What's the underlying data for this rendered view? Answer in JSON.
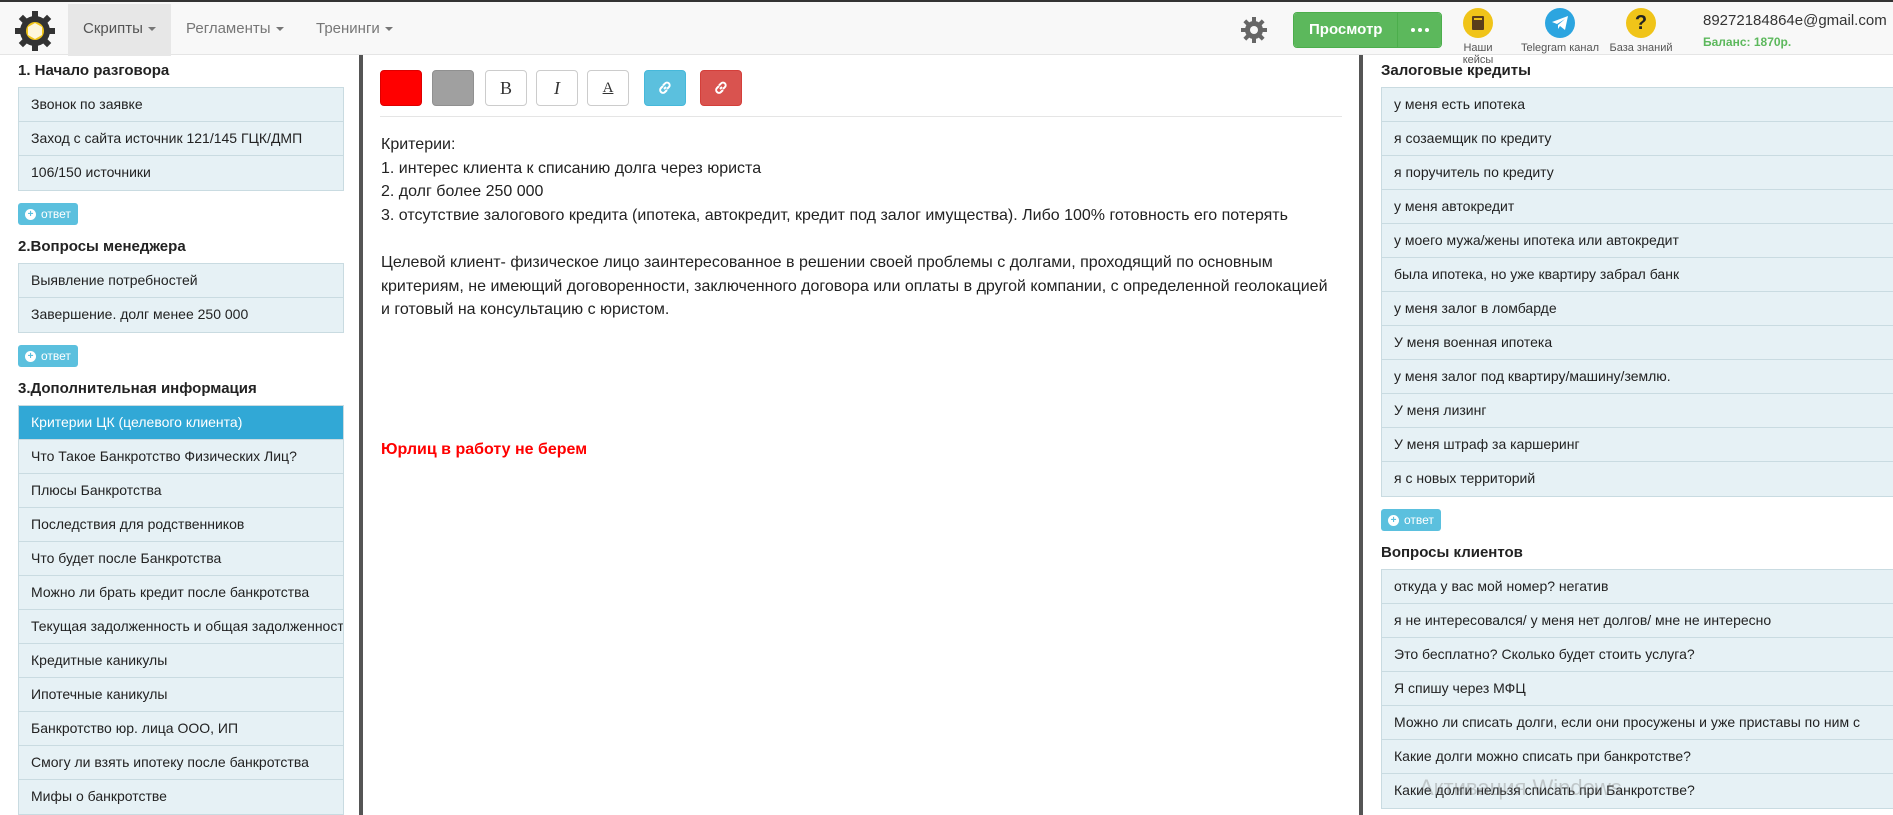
{
  "nav": {
    "items": [
      {
        "label": "Скрипты"
      },
      {
        "label": "Регламенты"
      },
      {
        "label": "Тренинги"
      }
    ],
    "view_label": "Просмотр",
    "links": [
      {
        "label": "Наши кейсы",
        "icon": "book-icon",
        "color": "#f0c419"
      },
      {
        "label": "Telegram канал",
        "icon": "telegram-icon",
        "color": "#2ca5e0"
      },
      {
        "label": "База знаний",
        "icon": "question-icon",
        "color": "#f0c419"
      }
    ],
    "user_email": "89272184864e@gmail.com",
    "balance": "Баланс: 1870р."
  },
  "left": {
    "sections": [
      {
        "title": "1. Начало разговора",
        "items": [
          "Звонок по заявке",
          "Заход с сайта источник 121/145 ГЦК/ДМП",
          "106/150 источники"
        ]
      },
      {
        "title": "2.Вопросы менеджера",
        "items": [
          "Выявление потребностей",
          "Завершение. долг менее 250 000"
        ]
      },
      {
        "title": "3.Дополнительная информация",
        "items": [
          "Критерии ЦК (целевого клиента)",
          "Что Такое Банкротство Физических Лиц?",
          "Плюсы Банкротства",
          "Последствия для родственников",
          "Что будет после Банкротства",
          "Можно ли брать кредит после банкротства",
          "Текущая задолженность и общая задолженность",
          "Кредитные каникулы",
          "Ипотечные каникулы",
          "Банкротство юр. лица ООО, ИП",
          "Смогу ли взять ипотеку после банкротства",
          "Мифы о банкротстве"
        ]
      }
    ],
    "answer_label": "ответ"
  },
  "editor": {
    "colors": {
      "red": "#ff0000",
      "gray": "#a0a0a0",
      "link": "#5bc0de",
      "unlink": "#d9534f"
    },
    "bold": "B",
    "italic": "I",
    "underline": "A",
    "lines": [
      "Критерии:",
      "1. интерес клиента к списанию долга через юриста",
      "2. долг более 250 000",
      "3. отсутствие залогового кредита (ипотека, автокредит, кредит под залог имущества). Либо 100% готовность его потерять"
    ],
    "paragraph": "Целевой клиент- физическое лицо заинтересованное в решении своей проблемы с долгами, проходящий по основным критериям, не имеющий договоренности, заключенного договора или оплаты в другой компании, с определенной геолокацией и готовый на консультацию с юристом.",
    "red_note": "Юрлиц в работу не берем"
  },
  "right": {
    "sections": [
      {
        "title": "Залоговые кредиты",
        "items": [
          "у меня есть ипотека",
          "я созаемщик по кредиту",
          "я поручитель по кредиту",
          "у меня автокредит",
          "у моего мужа/жены ипотека или автокредит",
          "была ипотека, но уже квартиру забрал банк",
          "у меня залог в ломбарде",
          "У меня военная ипотека",
          "у меня залог под квартиру/машину/землю.",
          "У меня лизинг",
          "У меня штраф за каршеринг",
          "я с новых территорий"
        ]
      },
      {
        "title": "Вопросы клиентов",
        "items": [
          "откуда у вас мой номер? негатив",
          "я не интересовался/ у меня нет долгов/ мне не интересно",
          "Это бесплатно? Сколько будет стоить услуга?",
          "Я спишу через МФЦ",
          "Можно ли списать долги, если они просужены и уже приставы по ним с",
          "Какие долги можно списать при банкротстве?",
          "Какие долги нельзя списать при Банкротстве?"
        ]
      }
    ],
    "answer_label": "ответ"
  },
  "watermark": "Активация Windows"
}
